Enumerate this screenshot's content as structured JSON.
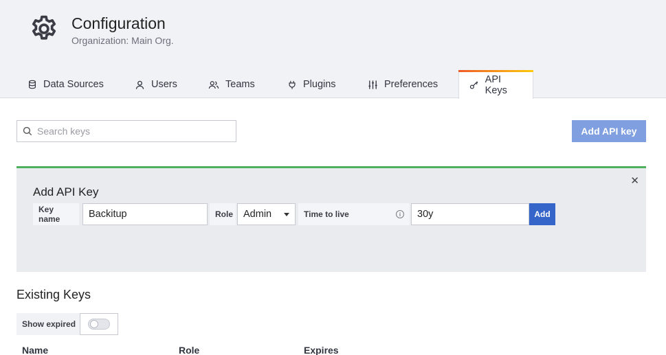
{
  "header": {
    "icon": "gear-icon",
    "title": "Configuration",
    "subtitle": "Organization: Main Org."
  },
  "tabs": [
    {
      "label": "Data Sources",
      "icon": "database-icon",
      "active": false
    },
    {
      "label": "Users",
      "icon": "user-icon",
      "active": false
    },
    {
      "label": "Teams",
      "icon": "users-icon",
      "active": false
    },
    {
      "label": "Plugins",
      "icon": "plug-icon",
      "active": false
    },
    {
      "label": "Preferences",
      "icon": "sliders-icon",
      "active": false
    },
    {
      "label": "API Keys",
      "icon": "key-icon",
      "active": true
    }
  ],
  "search": {
    "placeholder": "Search keys",
    "value": ""
  },
  "toolbar": {
    "add_api_key_label": "Add API key"
  },
  "add_panel": {
    "title": "Add API Key",
    "key_name_label": "Key name",
    "key_name_value": "Backitup",
    "role_label": "Role",
    "role_value": "Admin",
    "ttl_label": "Time to live",
    "ttl_value": "30y",
    "add_label": "Add",
    "close_glyph": "✕"
  },
  "existing": {
    "title": "Existing Keys",
    "show_expired_label": "Show expired",
    "show_expired": false,
    "columns": [
      "Name",
      "Role",
      "Expires"
    ]
  },
  "colors": {
    "accent_blue": "#3565c8",
    "add_key_button": "#7f9fe0",
    "panel_border": "#4fb15d",
    "tab_gradient": [
      "#f05a28",
      "#fbca0a"
    ]
  }
}
